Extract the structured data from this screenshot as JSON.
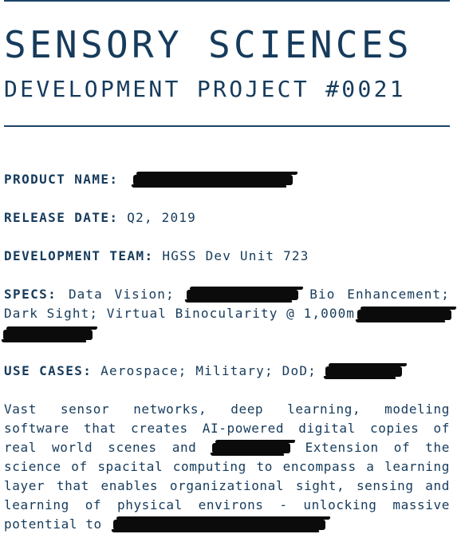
{
  "header": {
    "title": "SENSORY SCIENCES",
    "subtitle": "DEVELOPMENT PROJECT #0021"
  },
  "fields": {
    "product_name": {
      "label": "PRODUCT NAME:"
    },
    "release_date": {
      "label": "RELEASE DATE:",
      "value": "Q2, 2019"
    },
    "development_team": {
      "label": "DEVELOPMENT TEAM:",
      "value": "HGSS Dev Unit 723"
    },
    "specs": {
      "label": "SPECS:",
      "line1_a": "Data Vision;",
      "line1_b": "Bio Enhancement;",
      "line2": "Dark Sight; Virtual Binocularity @ 1,000m"
    },
    "use_cases": {
      "label": "USE CASES:",
      "value": "Aerospace; Military; DoD;"
    }
  },
  "description": {
    "line1": "Vast sensor networks, deep learning, modeling",
    "line2": "software that creates AI-powered digital copies of",
    "line3_a": "real world scenes and",
    "line3_b": "Extension of the",
    "line4": "science of spacital computing to encompass a learning",
    "line5": "layer that enables organizational sight, sensing and",
    "line6": "learning of physical environs - unlocking massive",
    "line7": "potential to"
  },
  "colors": {
    "text": "#163b5c",
    "rule": "#1d4466",
    "redaction": "#0b0b0b"
  }
}
